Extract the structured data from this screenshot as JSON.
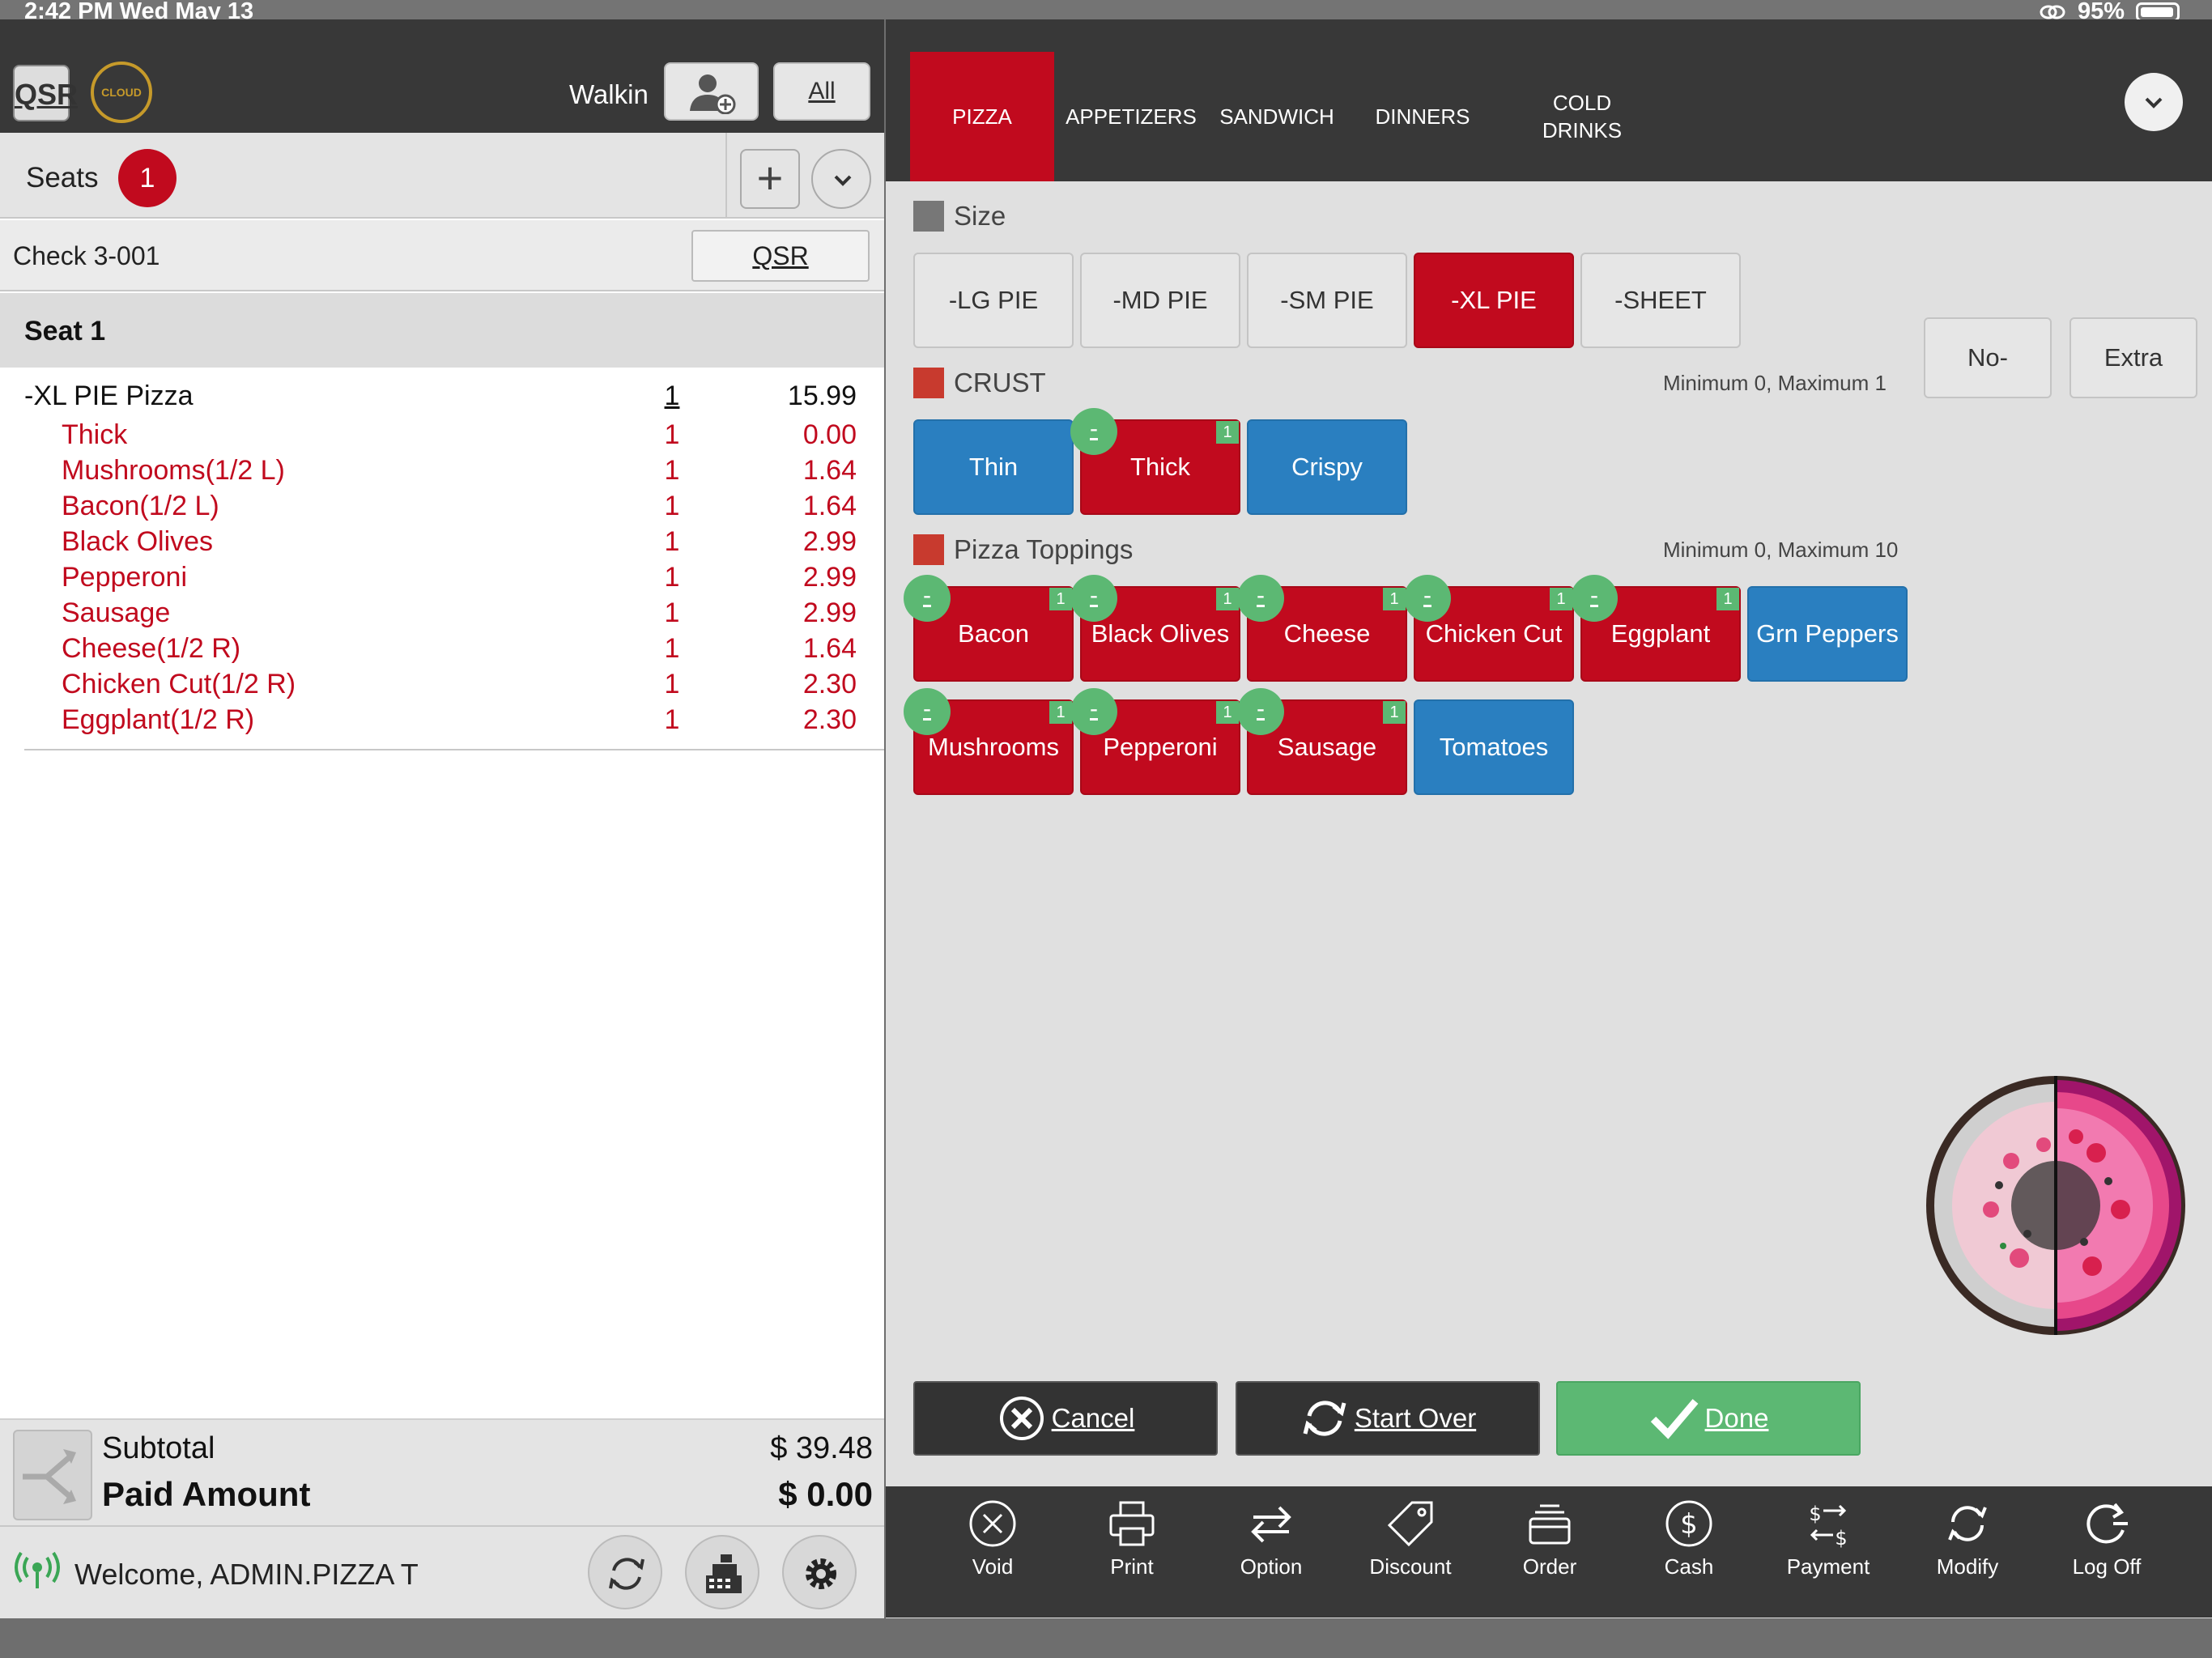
{
  "status": {
    "time": "2:42 PM  Wed May 13",
    "battery": "95%"
  },
  "header": {
    "qsr_logo": "QSR",
    "cloud_logo": "CLOUD",
    "walkin": "Walkin",
    "all_button": "All"
  },
  "seats": {
    "label": "Seats",
    "count": "1"
  },
  "check": {
    "label": "Check  3-001",
    "qsr_button": "QSR"
  },
  "seat_header": "Seat 1",
  "order_items": [
    {
      "name": "-XL PIE Pizza",
      "qty": "1",
      "price": "15.99"
    },
    {
      "name": "Thick",
      "qty": "1",
      "price": "0.00"
    },
    {
      "name": "Mushrooms(1/2 L)",
      "qty": "1",
      "price": "1.64"
    },
    {
      "name": "Bacon(1/2 L)",
      "qty": "1",
      "price": "1.64"
    },
    {
      "name": "Black Olives",
      "qty": "1",
      "price": "2.99"
    },
    {
      "name": "Pepperoni",
      "qty": "1",
      "price": "2.99"
    },
    {
      "name": "Sausage",
      "qty": "1",
      "price": "2.99"
    },
    {
      "name": "Cheese(1/2 R)",
      "qty": "1",
      "price": "1.64"
    },
    {
      "name": "Chicken Cut(1/2 R)",
      "qty": "1",
      "price": "2.30"
    },
    {
      "name": "Eggplant(1/2 R)",
      "qty": "1",
      "price": "2.30"
    }
  ],
  "totals": {
    "subtotal_label": "Subtotal",
    "subtotal": "$ 39.48",
    "paid_label": "Paid Amount",
    "paid": "$ 0.00"
  },
  "footer": {
    "welcome": "Welcome, ADMIN.PIZZA T"
  },
  "tabs": [
    "PIZZA",
    "APPETIZERS",
    "SANDWICH",
    "DINNERS",
    "COLD DRINKS"
  ],
  "size_group": {
    "title": "Size",
    "options": [
      "-LG PIE",
      "-MD PIE",
      "-SM PIE",
      "-XL PIE",
      "-SHEET"
    ]
  },
  "modifiers": {
    "no": "No-",
    "extra": "Extra"
  },
  "crust_group": {
    "title": "CRUST",
    "minmax": "Minimum 0, Maximum 1",
    "options": [
      "Thin",
      "Thick",
      "Crispy"
    ],
    "thick_count": "1"
  },
  "toppings_group": {
    "title": "Pizza Toppings",
    "minmax": "Minimum 0, Maximum 10",
    "options": [
      "Bacon",
      "Black Olives",
      "Cheese",
      "Chicken Cut",
      "Eggplant",
      "Grn Peppers",
      "Mushrooms",
      "Pepperoni",
      "Sausage",
      "Tomatoes"
    ],
    "count": "1",
    "minus": "-"
  },
  "actions": {
    "cancel": "Cancel",
    "start_over": "Start Over",
    "done": "Done"
  },
  "bottom_bar": [
    "Void",
    "Print",
    "Option",
    "Discount",
    "Order",
    "Cash",
    "Payment",
    "Modify",
    "Log Off"
  ],
  "colors": {
    "red": "#c10a1e",
    "blue": "#2a7fc0",
    "green": "#5cb873",
    "dark": "#383838"
  }
}
